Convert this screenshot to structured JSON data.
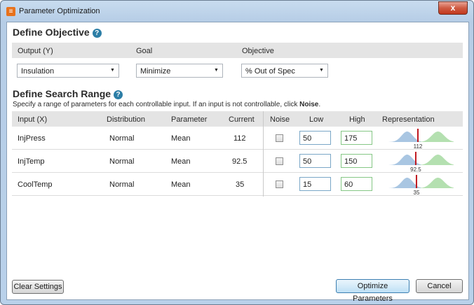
{
  "window": {
    "title": "Parameter Optimization",
    "close_label": "x"
  },
  "objective": {
    "heading": "Define Objective",
    "columns": {
      "output": "Output (Y)",
      "goal": "Goal",
      "objective": "Objective"
    },
    "output_value": "Insulation",
    "goal_value": "Minimize",
    "objective_value": "% Out of Spec"
  },
  "search": {
    "heading": "Define Search Range",
    "subtitle_prefix": "Specify a range of parameters for each controllable input. If an input is not controllable, click ",
    "subtitle_bold": "Noise",
    "subtitle_suffix": ".",
    "columns": [
      "Input (X)",
      "Distribution",
      "Parameter",
      "Current",
      "Noise",
      "Low",
      "High",
      "Representation"
    ],
    "rows": [
      {
        "input": "InjPress",
        "distribution": "Normal",
        "parameter": "Mean",
        "current": "112",
        "noise": false,
        "low": "50",
        "high": "175",
        "rep_label": "112",
        "rep_pos": 0.5
      },
      {
        "input": "InjTemp",
        "distribution": "Normal",
        "parameter": "Mean",
        "current": "92.5",
        "noise": false,
        "low": "50",
        "high": "150",
        "rep_label": "92.5",
        "rep_pos": 0.47
      },
      {
        "input": "CoolTemp",
        "distribution": "Normal",
        "parameter": "Mean",
        "current": "35",
        "noise": false,
        "low": "15",
        "high": "60",
        "rep_label": "35",
        "rep_pos": 0.48
      }
    ]
  },
  "buttons": {
    "clear": "Clear Settings",
    "optimize": "Optimize Parameters",
    "cancel": "Cancel"
  },
  "colors": {
    "low_curve": "#a9c6e2",
    "high_curve": "#b4e0b0",
    "marker": "#c0181f"
  }
}
